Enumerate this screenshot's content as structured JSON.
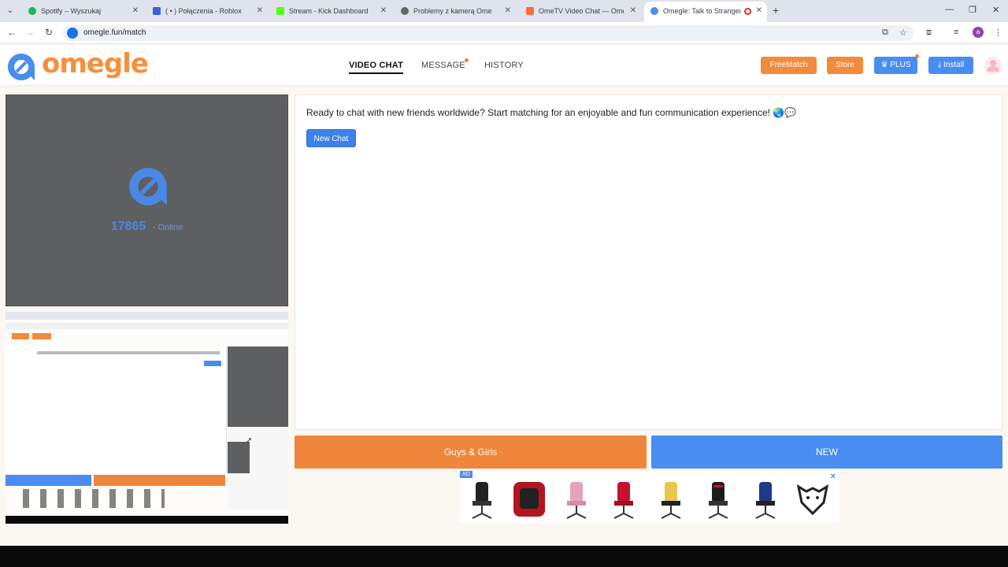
{
  "browser": {
    "tabs": [
      {
        "title": "Spotify – Wyszukaj",
        "color": "#1db954"
      },
      {
        "title": "( • ) Połączenia - Roblox",
        "color": "#3c61d6"
      },
      {
        "title": "Stream - Kick Dashboard",
        "color": "#53fc18"
      },
      {
        "title": "Problemy z kamerą Ome",
        "color": "#666666"
      },
      {
        "title": "OmeTV Video Chat — Omegle",
        "color": "#ff6a3d"
      },
      {
        "title": "Omegle: Talk to Strangers v",
        "color": "#4a8df0"
      }
    ],
    "url": "omegle.fun/match",
    "profile_initial": "a"
  },
  "header": {
    "logo_text": "omegle",
    "nav": {
      "video_chat": "VIDEO CHAT",
      "message": "MESSAGE",
      "history": "HISTORY"
    },
    "buttons": {
      "freematch": "FreeMatch",
      "store": "Store",
      "plus": "PLUS",
      "install": "Install"
    }
  },
  "stranger": {
    "online_count": "17865",
    "online_label": "- Online"
  },
  "chat": {
    "message": "Ready to chat with new friends worldwide? Start matching for an enjoyable and fun communication experience! 🌏💬",
    "new_chat_label": "New Chat"
  },
  "controls": {
    "gender_filter": "Guys & Girls",
    "new_label": "NEW"
  },
  "ad": {
    "tag": "AD",
    "close": "✕"
  },
  "colors": {
    "brand_orange": "#f28b3b",
    "brand_blue": "#4a8df0",
    "video_bg": "#5e5f61"
  }
}
